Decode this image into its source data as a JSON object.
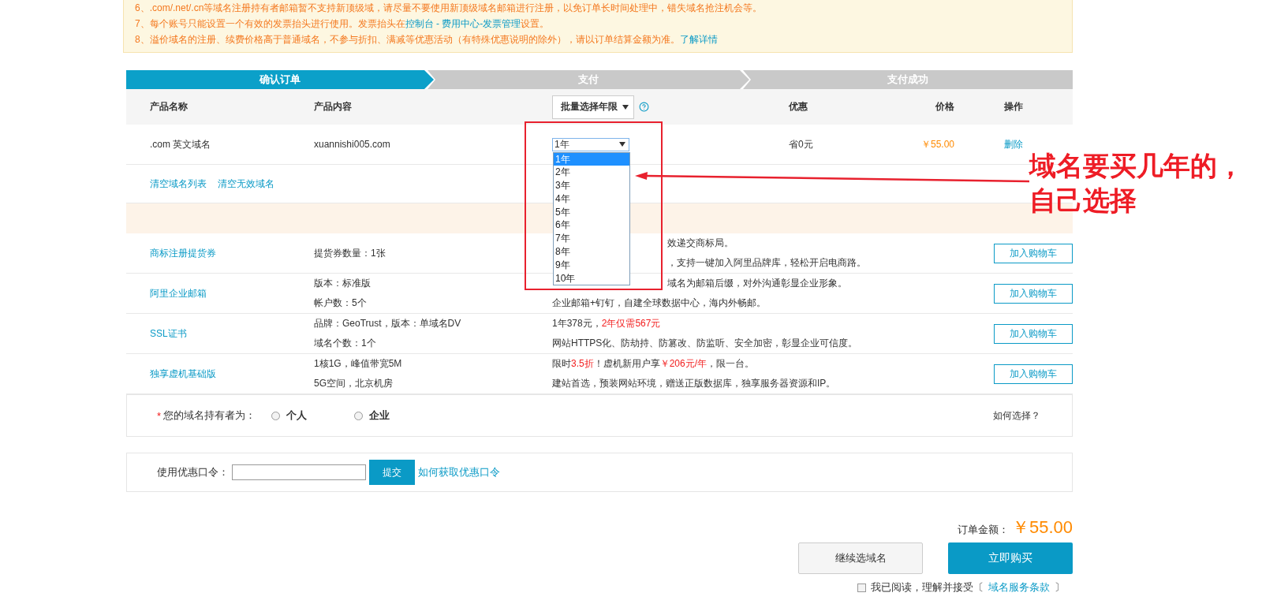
{
  "notice": {
    "lines": [
      {
        "text": "6、.com/.net/.cn等域名注册持有者邮箱暂不支持新顶级域，请尽量不要使用新顶级域名邮箱进行注册，以免订单长时间处理中，错失域名抢注机会等。"
      },
      {
        "text": "7、每个账号只能设置一个有效的发票抬头进行使用。发票抬头在",
        "link": "控制台 - 费用中心-发票管理",
        "after": "设置。"
      },
      {
        "text": "8、溢价域名的注册、续费价格高于普通域名，不参与折扣、满减等优惠活动（有特殊优惠说明的除外），请以订单结算金额为准。",
        "link": "了解详情"
      }
    ]
  },
  "steps": [
    {
      "label": "确认订单",
      "selected": true
    },
    {
      "label": "支付",
      "selected": false
    },
    {
      "label": "支付成功",
      "selected": false
    }
  ],
  "table": {
    "columns": [
      "产品名称",
      "产品内容",
      "批量选择年限",
      "优惠",
      "价格",
      "操作"
    ],
    "row": {
      "name": ".com 英文域名",
      "content": "xuannishi005.com",
      "year": {
        "value": "1年",
        "expanded": true,
        "options": [
          {
            "label": "1年",
            "selected": true
          },
          {
            "label": "2年",
            "selected": false
          },
          {
            "label": "3年",
            "selected": false
          },
          {
            "label": "4年",
            "selected": false
          },
          {
            "label": "5年",
            "selected": false
          },
          {
            "label": "6年",
            "selected": false
          },
          {
            "label": "7年",
            "selected": false
          },
          {
            "label": "8年",
            "selected": false
          },
          {
            "label": "9年",
            "selected": false
          },
          {
            "label": "10年",
            "selected": false
          }
        ]
      },
      "discount": "省0元",
      "price": "￥55.00",
      "action": "删除"
    },
    "links": [
      "清空域名列表",
      "清空无效域名"
    ]
  },
  "upsells": [
    {
      "name": "商标注册提货券",
      "details": [
        "提货券数量：1张"
      ],
      "desc": [
        {
          "kind": "partial",
          "parts": [
            {
              "text": "效递交商标局。",
              "highlight": false
            }
          ]
        },
        {
          "kind": "partial",
          "parts": [
            {
              "text": "，支持一键加入阿里品牌库，轻松开启电商路。",
              "highlight": false
            }
          ]
        }
      ],
      "button": "加入购物车"
    },
    {
      "name": "阿里企业邮箱",
      "details": [
        "版本：标准版",
        "帐户数：5个"
      ],
      "desc": [
        {
          "kind": "partial",
          "parts": [
            {
              "text": "域名为邮箱后缀，对外沟通彰显企业形象。",
              "highlight": false
            }
          ]
        },
        {
          "kind": "full",
          "parts": [
            {
              "text": "企业邮箱+钉钉，自建全球数据中心，海内外畅邮。",
              "highlight": false
            }
          ]
        }
      ],
      "button": "加入购物车"
    },
    {
      "name": "SSL证书",
      "details": [
        "品牌：GeoTrust，版本：单域名DV",
        "域名个数：1个"
      ],
      "desc": [
        {
          "kind": "full",
          "parts": [
            {
              "text": "1年378元，",
              "highlight": false
            },
            {
              "text": "2年仅需567元",
              "highlight": true
            }
          ]
        },
        {
          "kind": "full",
          "parts": [
            {
              "text": "网站HTTPS化、防劫持、防篡改、防监听、安全加密，彰显企业可信度。",
              "highlight": false
            }
          ]
        }
      ],
      "button": "加入购物车"
    },
    {
      "name": "独享虚机基础版",
      "details": [
        "1核1G，峰值带宽5M",
        "5G空间，北京机房"
      ],
      "desc": [
        {
          "kind": "full",
          "parts": [
            {
              "text": "限时",
              "highlight": false
            },
            {
              "text": "3.5折",
              "highlight": true
            },
            {
              "text": "！虚机新用户享",
              "highlight": false
            },
            {
              "text": "￥206元/年",
              "highlight": true
            },
            {
              "text": "，限一台。",
              "highlight": false
            }
          ]
        },
        {
          "kind": "full",
          "parts": [
            {
              "text": "建站首选，预装网站环境，赠送正版数据库，独享服务器资源和IP。",
              "highlight": false
            }
          ]
        }
      ],
      "button": "加入购物车"
    }
  ],
  "owner": {
    "required": "*",
    "label": "您的域名持有者为：",
    "options": [
      {
        "label": "个人",
        "selected": false
      },
      {
        "label": "企业",
        "selected": false
      }
    ],
    "help": "如何选择？"
  },
  "coupon": {
    "label": "使用优惠口令：",
    "submit": "提交",
    "link": "如何获取优惠口令"
  },
  "total": {
    "label": "订单金额：",
    "amount": "￥55.00"
  },
  "actions": {
    "continue": "继续选域名",
    "buy": "立即购买"
  },
  "agree": {
    "checked": false,
    "text": "我已阅读，理解并接受〔",
    "link": "域名服务条款",
    "close": "〕"
  },
  "annotation": {
    "lines": [
      "域名要买几年的，",
      "自己选择"
    ]
  }
}
